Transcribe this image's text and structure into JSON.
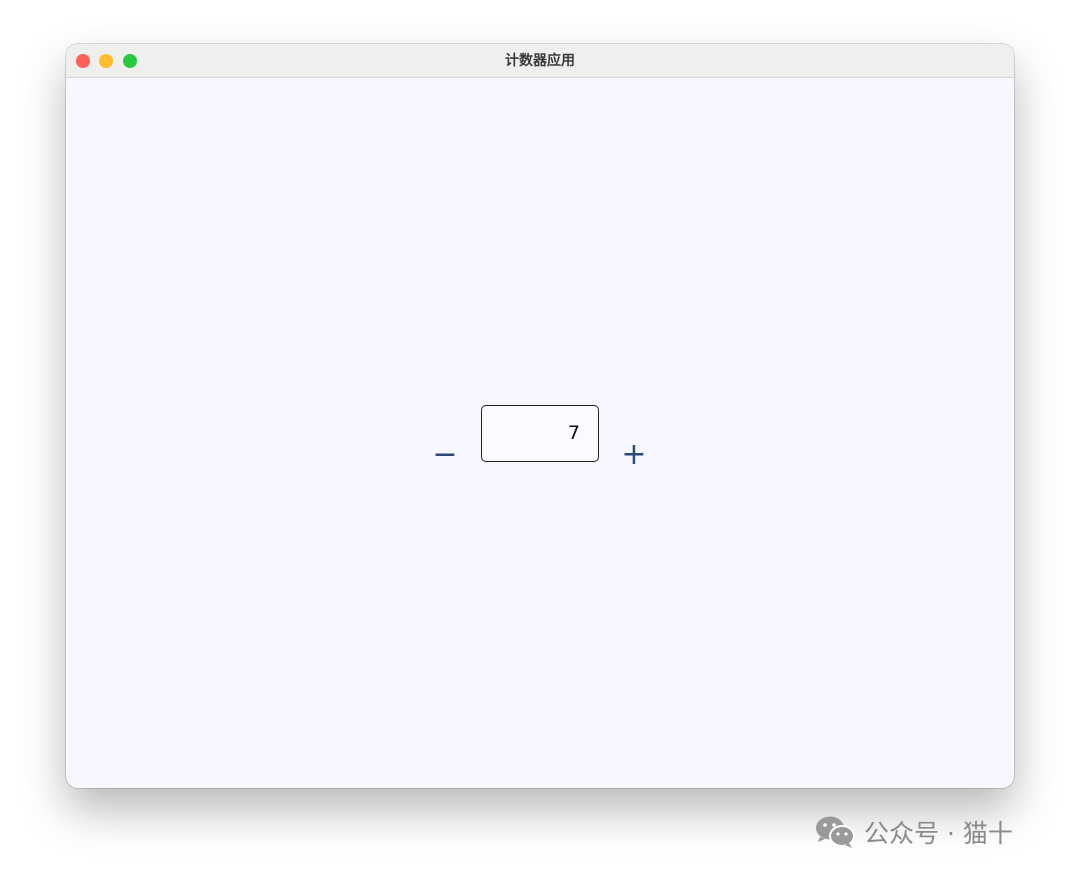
{
  "window": {
    "title": "计数器应用"
  },
  "counter": {
    "value": "7",
    "decrement_label": "−",
    "increment_label": "+"
  },
  "watermark": {
    "text": "公众号 · 猫十",
    "icon": "wechat-icon"
  },
  "colors": {
    "window_bg": "#f7f8ff",
    "titlebar_bg": "#efefed",
    "button_color": "#2b4a78",
    "close": "#fe5f57",
    "minimize": "#febc2e",
    "maximize": "#28c840"
  }
}
